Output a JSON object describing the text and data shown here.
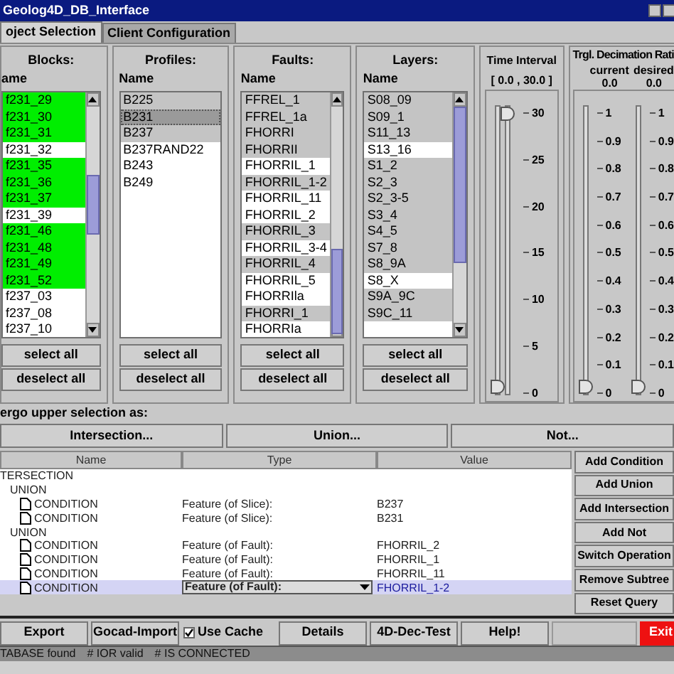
{
  "window": {
    "title": "Geolog4D_DB_Interface"
  },
  "tabs": [
    {
      "label": "oject Selection",
      "selected": true
    },
    {
      "label": "Client Configuration",
      "selected": false
    }
  ],
  "lists": [
    {
      "title": "Blocks:",
      "column": "ame",
      "items": [
        {
          "label": "f231_29",
          "selected": true
        },
        {
          "label": "f231_30",
          "selected": true
        },
        {
          "label": "f231_31",
          "selected": true
        },
        {
          "label": "f231_32",
          "selected": false
        },
        {
          "label": "f231_35",
          "selected": true
        },
        {
          "label": "f231_36",
          "selected": true
        },
        {
          "label": "f231_37",
          "selected": true
        },
        {
          "label": "f231_39",
          "selected": false
        },
        {
          "label": "f231_46",
          "selected": true
        },
        {
          "label": "f231_48",
          "selected": true
        },
        {
          "label": "f231_49",
          "selected": true
        },
        {
          "label": "f231_52",
          "selected": true
        },
        {
          "label": "f237_03",
          "selected": false
        },
        {
          "label": "f237_08",
          "selected": false
        },
        {
          "label": "f237_10",
          "selected": false
        }
      ],
      "buttons": [
        "select all",
        "deselect all"
      ]
    },
    {
      "title": "Profiles:",
      "column": "Name",
      "items": [
        {
          "label": "B225",
          "selected": true,
          "focused": false
        },
        {
          "label": "B231",
          "selected": true,
          "focused": true
        },
        {
          "label": "B237",
          "selected": true,
          "focused": false
        },
        {
          "label": "B237RAND22",
          "selected": false,
          "focused": false
        },
        {
          "label": "B243",
          "selected": false,
          "focused": false
        },
        {
          "label": "B249",
          "selected": false,
          "focused": false
        }
      ],
      "buttons": [
        "select all",
        "deselect all"
      ]
    },
    {
      "title": "Faults:",
      "column": "Name",
      "items": [
        {
          "label": "FFREL_1",
          "selected": true
        },
        {
          "label": "FFREL_1a",
          "selected": true
        },
        {
          "label": "FHORRI",
          "selected": true
        },
        {
          "label": "FHORRII",
          "selected": true
        },
        {
          "label": "FHORRIL_1",
          "selected": false
        },
        {
          "label": "FHORRIL_1-2",
          "selected": true
        },
        {
          "label": "FHORRIL_11",
          "selected": false
        },
        {
          "label": "FHORRIL_2",
          "selected": false
        },
        {
          "label": "FHORRIL_3",
          "selected": true
        },
        {
          "label": "FHORRIL_3-4",
          "selected": false
        },
        {
          "label": "FHORRIL_4",
          "selected": true
        },
        {
          "label": "FHORRIL_5",
          "selected": false
        },
        {
          "label": "FHORRIla",
          "selected": false
        },
        {
          "label": "FHORRI_1",
          "selected": true
        },
        {
          "label": "FHORRIa",
          "selected": false
        }
      ],
      "buttons": [
        "select all",
        "deselect all"
      ]
    },
    {
      "title": "Layers:",
      "column": "Name",
      "items": [
        {
          "label": "S08_09",
          "selected": true
        },
        {
          "label": "S09_1",
          "selected": true
        },
        {
          "label": "S11_13",
          "selected": true
        },
        {
          "label": "S13_16",
          "selected": false
        },
        {
          "label": "S1_2",
          "selected": true
        },
        {
          "label": "S2_3",
          "selected": true
        },
        {
          "label": "S2_3-5",
          "selected": true
        },
        {
          "label": "S3_4",
          "selected": true
        },
        {
          "label": "S4_5",
          "selected": true
        },
        {
          "label": "S7_8",
          "selected": true
        },
        {
          "label": "S8_9A",
          "selected": true
        },
        {
          "label": "S8_X",
          "selected": false
        },
        {
          "label": "S9A_9C",
          "selected": true
        },
        {
          "label": "S9C_11",
          "selected": true
        }
      ],
      "buttons": [
        "select all",
        "deselect all"
      ]
    }
  ],
  "time_interval": {
    "title": "Time Interval",
    "range": "[ 0.0 , 30.0 ]",
    "start": {
      "level": 0
    },
    "end": {
      "level": 1
    },
    "ticks": [
      "30",
      "25",
      "20",
      "15",
      "10",
      "5",
      "0"
    ]
  },
  "decimation": {
    "title": "Trgl. Decimation Rati",
    "sliders": [
      {
        "label": "current",
        "value": "0.0",
        "level": 0,
        "ticks": [
          "1",
          "0.9",
          "0.8",
          "0.7",
          "0.6",
          "0.5",
          "0.4",
          "0.3",
          "0.2",
          "0.1",
          "0"
        ]
      },
      {
        "label": "desired",
        "value": "0.0",
        "level": 0,
        "ticks": [
          "1",
          "0.9",
          "0.8",
          "0.7",
          "0.6",
          "0.5",
          "0.4",
          "0.3",
          "0.2",
          "0.1",
          "0"
        ]
      }
    ]
  },
  "merge": {
    "label": "ergo upper selection as:",
    "buttons": [
      "Intersection...",
      "Union...",
      "Not..."
    ]
  },
  "query": {
    "columns": [
      "Name",
      "Type",
      "Value"
    ],
    "tree": [
      {
        "name": "TERSECTION",
        "selected": false,
        "children": [
          {
            "name": "UNION",
            "selected": false,
            "children": [
              {
                "name": "CONDITION",
                "type": "Feature (of Slice):",
                "value": "B237",
                "selected": false
              },
              {
                "name": "CONDITION",
                "type": "Feature (of Slice):",
                "value": "B231",
                "selected": false
              }
            ]
          },
          {
            "name": "UNION",
            "selected": false,
            "children": [
              {
                "name": "CONDITION",
                "type": "Feature (of Fault):",
                "value": "FHORRIL_2",
                "selected": false
              },
              {
                "name": "CONDITION",
                "type": "Feature (of Fault):",
                "value": "FHORRIL_1",
                "selected": false
              },
              {
                "name": "CONDITION",
                "type": "Feature (of Fault):",
                "value": "FHORRIL_11",
                "selected": false
              },
              {
                "name": "CONDITION",
                "type": "Feature (of Fault):",
                "value": "FHORRIL_1-2",
                "selected": true
              }
            ]
          }
        ]
      }
    ],
    "actions": [
      "Add Condition",
      "Add Union",
      "Add Intersection",
      "Add Not",
      "Switch Operation",
      "Remove Subtree",
      "Reset Query"
    ]
  },
  "toolbar": [
    {
      "kind": "button",
      "label": "Export"
    },
    {
      "kind": "button",
      "label": "Gocad-Import"
    },
    {
      "kind": "checkbox",
      "label": "Use Cache",
      "checked": true
    },
    {
      "kind": "button",
      "label": "Details"
    },
    {
      "kind": "button",
      "label": "4D-Dec-Test"
    },
    {
      "kind": "button",
      "label": "Help!"
    },
    {
      "kind": "spacer"
    },
    {
      "kind": "danger",
      "label": "Exit"
    }
  ],
  "status_bar": [
    "TABASE found",
    "# IOR valid",
    "# IS CONNECTED"
  ]
}
